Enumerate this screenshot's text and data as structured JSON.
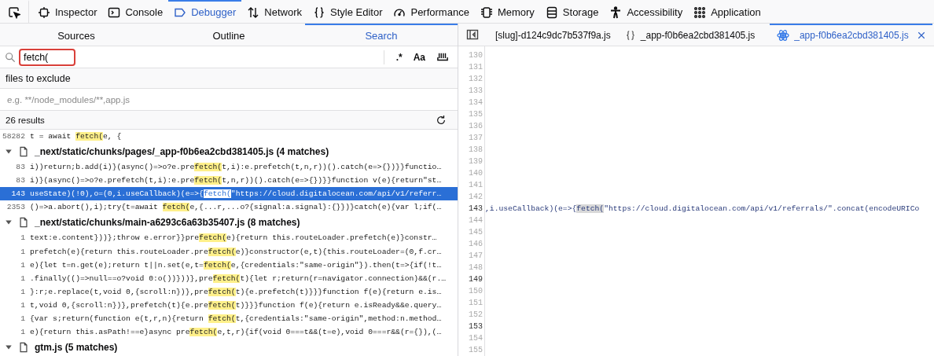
{
  "toolbar": {
    "tools": [
      {
        "kind": "inspector",
        "label": "Inspector",
        "selected": false
      },
      {
        "kind": "console",
        "label": "Console",
        "selected": false
      },
      {
        "kind": "debugger",
        "label": "Debugger",
        "selected": true
      },
      {
        "kind": "network",
        "label": "Network",
        "selected": false
      },
      {
        "kind": "style",
        "label": "Style Editor",
        "selected": false
      },
      {
        "kind": "performance",
        "label": "Performance",
        "selected": false
      },
      {
        "kind": "memory",
        "label": "Memory",
        "selected": false
      },
      {
        "kind": "storage",
        "label": "Storage",
        "selected": false
      },
      {
        "kind": "accessibility",
        "label": "Accessibility",
        "selected": false
      },
      {
        "kind": "application",
        "label": "Application",
        "selected": false
      }
    ]
  },
  "left_panel": {
    "tabs": [
      {
        "label": "Sources",
        "selected": false
      },
      {
        "label": "Outline",
        "selected": false
      },
      {
        "label": "Search",
        "selected": true
      }
    ],
    "search": {
      "value": "fetch(",
      "annotated": true
    },
    "search_options": [
      {
        "kind": "regex",
        "label": ".*",
        "on": false
      },
      {
        "kind": "case",
        "label": "Aa",
        "on": false
      },
      {
        "kind": "whole_word",
        "on": false
      }
    ],
    "exclude_label": "files to exclude",
    "exclude": {
      "placeholder": "e.g. **/node_modules/**,app.js"
    },
    "result_count": "26 results",
    "results": [
      {
        "kind": "match",
        "line": "58282",
        "before": "t = await ",
        "match": "fetch(",
        "after": "e, {",
        "selected": false
      },
      {
        "kind": "file",
        "title": "_next/static/chunks/pages/_app-f0b6ea2cbd381405.js (4 matches)",
        "expanded": true
      },
      {
        "kind": "match",
        "line": "83",
        "before": "i))return;b.add(i)}(async()=>o?e.pre",
        "match": "fetch(",
        "after": "t,i):e.prefetch(t,n,r))().catch(e=>{})}}functio…",
        "selected": false
      },
      {
        "kind": "match",
        "line": "83",
        "before": "i)}(async()=>o?e.prefetch(t,i):e.pre",
        "match": "fetch(",
        "after": "t,n,r))().catch(e=>{})}}function v(e){return\"st…",
        "selected": false
      },
      {
        "kind": "match",
        "line": "143",
        "before": "useState)(!0),o=(0,i.useCallback)(e=>{",
        "match": "fetch(",
        "after": "\"https://cloud.digitalocean.com/api/v1/referr…",
        "selected": true
      },
      {
        "kind": "match",
        "line": "2353",
        "before": "()=>a.abort(),i);try{t=await ",
        "match": "fetch(",
        "after": "e,{...r,...o?{signal:a.signal}:{}})}catch(e){var l;if(…",
        "selected": false
      },
      {
        "kind": "file",
        "title": "_next/static/chunks/main-a6293c6a63b35407.js (8 matches)",
        "expanded": true
      },
      {
        "kind": "match",
        "line": "1",
        "before": "text:e.content}))};throw e.error}}pre",
        "match": "fetch(",
        "after": "e){return this.routeLoader.prefetch(e)}constr…",
        "selected": false
      },
      {
        "kind": "match",
        "line": "1",
        "before": "prefetch(e){return this.routeLoader.pre",
        "match": "fetch(",
        "after": "e)}constructor(e,t){this.routeLoader=(0,f.cr…",
        "selected": false
      },
      {
        "kind": "match",
        "line": "1",
        "before": "e){let t=n.get(e);return t||n.set(e,t=",
        "match": "fetch(",
        "after": "e,{credentials:\"same-origin\"}).then(t=>{if(!t…",
        "selected": false
      },
      {
        "kind": "match",
        "line": "1",
        "before": ".finally(()=>null==o?void 0:o())}))},pre",
        "match": "fetch(",
        "after": "t){let r;return(r=navigator.connection)&&(r.…",
        "selected": false
      },
      {
        "kind": "match",
        "line": "1",
        "before": "}:r;e.replace(t,void 0,{scroll:n})},pre",
        "match": "fetch(",
        "after": "t){e.prefetch(t)}}}function f(e){return e.is…",
        "selected": false
      },
      {
        "kind": "match",
        "line": "1",
        "before": "t,void 0,{scroll:n})},prefetch(t){e.pre",
        "match": "fetch(",
        "after": "t)}}}function f(e){return e.isReady&&e.query…",
        "selected": false
      },
      {
        "kind": "match",
        "line": "1",
        "before": "{var s;return(function e(t,r,n){return ",
        "match": "fetch(",
        "after": "t,{credentials:\"same-origin\",method:n.method…",
        "selected": false
      },
      {
        "kind": "match",
        "line": "1",
        "before": "e){return this.asPath!==e}async pre",
        "match": "fetch(",
        "after": "e,t,r){if(void 0===t&&(t=e),void 0===r&&(r={}),(…",
        "selected": false
      },
      {
        "kind": "file",
        "title": "gtm.js (5 matches)",
        "expanded": true
      }
    ]
  },
  "editor": {
    "tabs": [
      {
        "kind": "plain",
        "label": "[slug]-d124c9dc7b537f9a.js",
        "selected": false
      },
      {
        "kind": "pretty",
        "label": "_app-f0b6ea2cbd381405.js",
        "selected": false
      },
      {
        "kind": "react",
        "label": "_app-f0b6ea2cbd381405.js",
        "selected": true
      }
    ],
    "lines": [
      {
        "number": "130",
        "active": false
      },
      {
        "number": "131",
        "active": false
      },
      {
        "number": "132",
        "active": false
      },
      {
        "number": "133",
        "active": false
      },
      {
        "number": "134",
        "active": false
      },
      {
        "number": "135",
        "active": false
      },
      {
        "number": "136",
        "active": false
      },
      {
        "number": "137",
        "active": false
      },
      {
        "number": "138",
        "active": false
      },
      {
        "number": "139",
        "active": false
      },
      {
        "number": "140",
        "active": false
      },
      {
        "number": "141",
        "active": false
      },
      {
        "number": "142",
        "active": false
      },
      {
        "number": "143",
        "active": true,
        "before": ",i.useCallback)(e=>{",
        "match": "fetch(",
        "after": "\"https://cloud.digitalocean.com/api/v1/referrals/\".concat(encodeURICo"
      },
      {
        "number": "144",
        "active": false
      },
      {
        "number": "145",
        "active": false
      },
      {
        "number": "146",
        "active": false
      },
      {
        "number": "147",
        "active": false
      },
      {
        "number": "148",
        "active": false
      },
      {
        "number": "149",
        "active": true
      },
      {
        "number": "150",
        "active": false
      },
      {
        "number": "151",
        "active": false
      },
      {
        "number": "152",
        "active": false
      },
      {
        "number": "153",
        "active": true
      },
      {
        "number": "154",
        "active": false
      },
      {
        "number": "155",
        "active": false
      }
    ]
  }
}
